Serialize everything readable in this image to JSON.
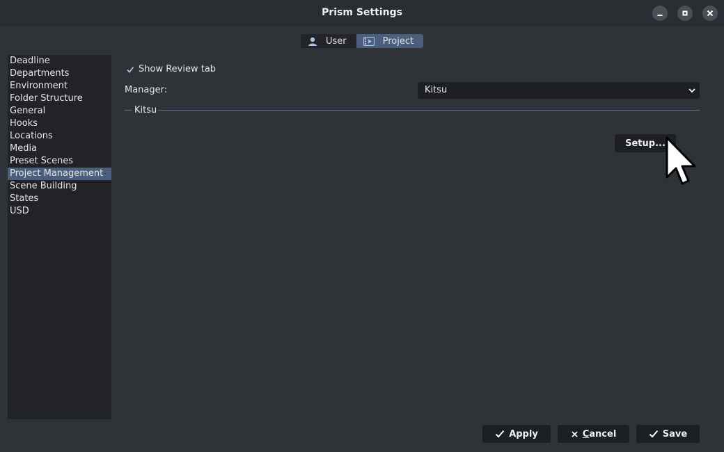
{
  "window": {
    "title": "Prism Settings"
  },
  "tabs": [
    {
      "label": "User",
      "icon": "user-icon",
      "active": false
    },
    {
      "label": "Project",
      "icon": "project-icon",
      "active": true
    }
  ],
  "sidebar": {
    "items": [
      {
        "label": "Deadline"
      },
      {
        "label": "Departments"
      },
      {
        "label": "Environment"
      },
      {
        "label": "Folder Structure"
      },
      {
        "label": "General"
      },
      {
        "label": "Hooks"
      },
      {
        "label": "Locations"
      },
      {
        "label": "Media"
      },
      {
        "label": "Preset Scenes"
      },
      {
        "label": "Project Management"
      },
      {
        "label": "Scene Building"
      },
      {
        "label": "States"
      },
      {
        "label": "USD"
      }
    ],
    "selected_index": 9
  },
  "main": {
    "show_review": {
      "label": "Show Review tab",
      "checked": true
    },
    "manager": {
      "label": "Manager:",
      "value": "Kitsu"
    },
    "group": {
      "title": "Kitsu"
    },
    "setup_button": "Setup..."
  },
  "footer": {
    "apply": "Apply",
    "cancel_first": "C",
    "cancel_rest": "ancel",
    "save": "Save"
  },
  "colors": {
    "accent": "#4a5e7d",
    "background": "#2f3338",
    "panel": "#212326"
  }
}
